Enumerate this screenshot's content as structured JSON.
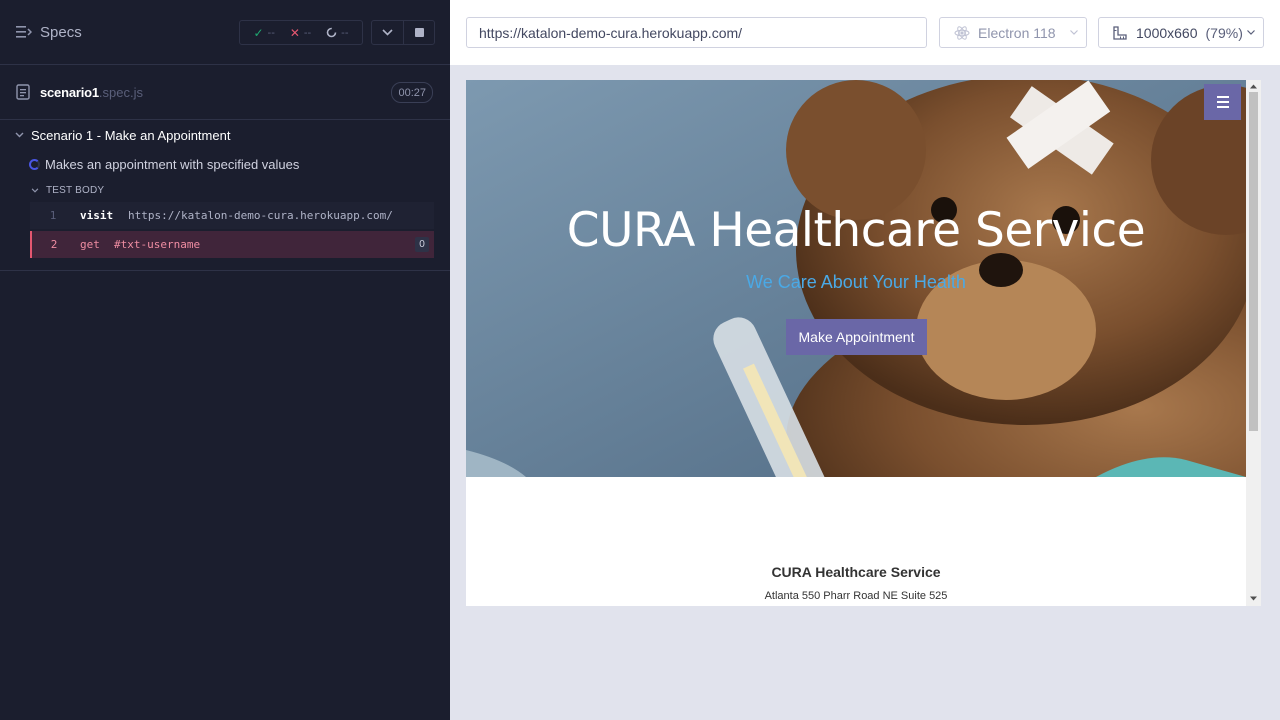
{
  "reporter": {
    "header": {
      "title": "Specs",
      "passed": "--",
      "failed": "--",
      "pending": "--"
    },
    "spec": {
      "name": "scenario1",
      "extension": ".spec.js",
      "duration": "00:27"
    },
    "suite": {
      "title": "Scenario 1 - Make an Appointment"
    },
    "test": {
      "title": "Makes an appointment with specified values"
    },
    "test_body_label": "TEST BODY",
    "commands": [
      {
        "number": "1",
        "name": "visit",
        "message": "https://katalon-demo-cura.herokuapp.com/"
      },
      {
        "number": "2",
        "name": "get",
        "message": "#txt-username",
        "count": "0"
      }
    ]
  },
  "aut": {
    "url": "https://katalon-demo-cura.herokuapp.com/",
    "browser": "Electron 118",
    "viewport": "1000x660",
    "scale": "(79%)",
    "page": {
      "hero_title": "CURA Healthcare Service",
      "hero_subtitle": "We Care About Your Health",
      "hero_button": "Make Appointment",
      "footer_title": "CURA Healthcare Service",
      "footer_address": "Atlanta 550 Pharr Road NE Suite 525"
    }
  },
  "colors": {
    "reporter_bg": "#1b1e2e",
    "pass": "#1fa971",
    "fail": "#e45770",
    "running": "#4956e3",
    "brand_purple": "#6a67a7",
    "subtitle_blue": "#4aa9e6"
  }
}
